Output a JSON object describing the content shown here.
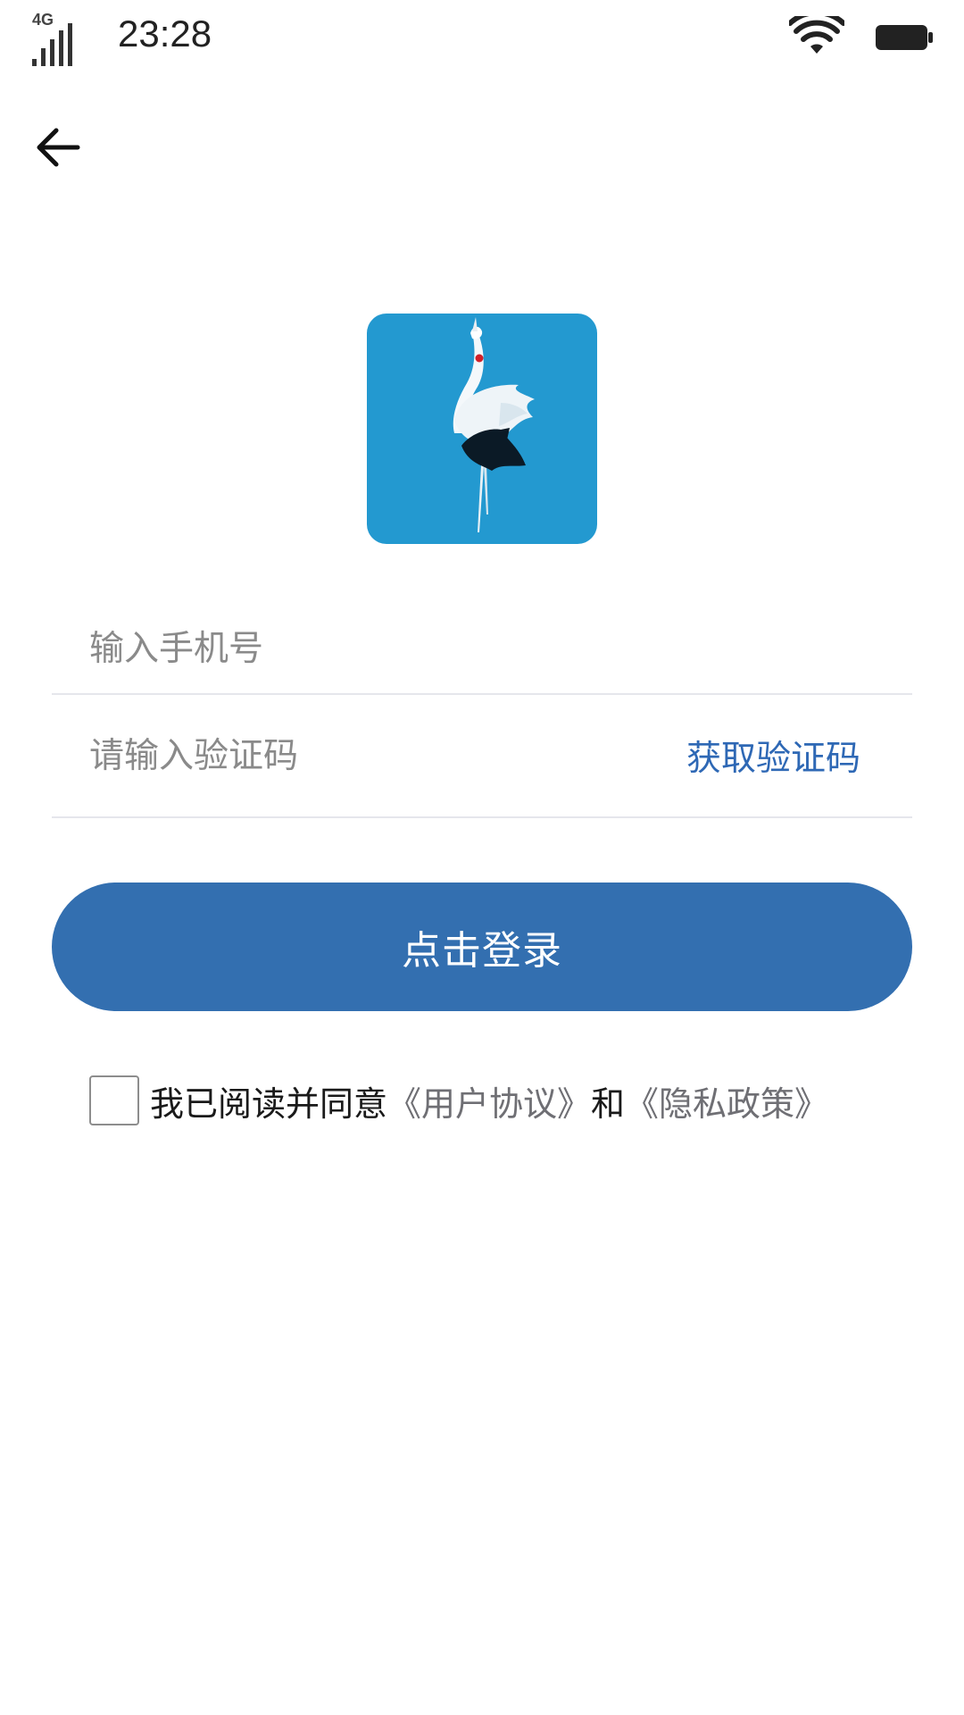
{
  "status_bar": {
    "network": "4G",
    "time": "23:28",
    "icons": [
      "signal-icon",
      "wifi-icon",
      "battery-icon"
    ]
  },
  "nav": {
    "back_icon": "arrow-left-icon"
  },
  "logo": {
    "icon": "crane-logo",
    "background_color": "#2399d0"
  },
  "form": {
    "phone_placeholder": "输入手机号",
    "phone_value": "",
    "code_placeholder": "请输入验证码",
    "code_value": "",
    "get_code_label": "获取验证码"
  },
  "login": {
    "label": "点击登录",
    "color": "#336fb0"
  },
  "agreement": {
    "checked": false,
    "prefix": "我已阅读并同意",
    "user_agreement": "《用户协议》",
    "and": "和",
    "privacy_policy": "《隐私政策》"
  }
}
